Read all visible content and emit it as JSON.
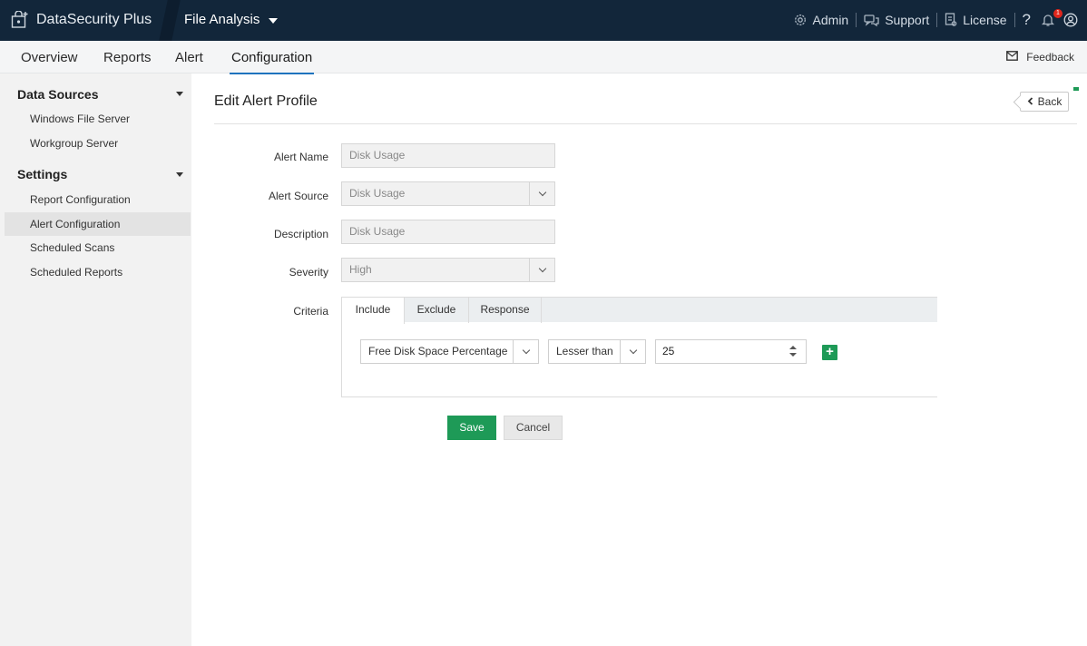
{
  "header": {
    "brand": "DataSecurity Plus",
    "product": "File Analysis",
    "admin_label": "Admin",
    "support_label": "Support",
    "license_label": "License",
    "help_glyph": "?",
    "notification_count": "1"
  },
  "nav": {
    "tabs": [
      "Overview",
      "Reports",
      "Alert",
      "Configuration"
    ],
    "active_tab": "Configuration",
    "feedback_label": "Feedback"
  },
  "sidebar": {
    "sections": [
      {
        "title": "Data Sources",
        "items": [
          "Windows File Server",
          "Workgroup Server"
        ]
      },
      {
        "title": "Settings",
        "items": [
          "Report Configuration",
          "Alert Configuration",
          "Scheduled Scans",
          "Scheduled Reports"
        ]
      }
    ],
    "active_item": "Alert Configuration"
  },
  "page": {
    "title": "Edit Alert Profile",
    "back_label": "Back"
  },
  "form": {
    "alert_name_label": "Alert Name",
    "alert_name_value": "Disk Usage",
    "alert_source_label": "Alert Source",
    "alert_source_value": "Disk Usage",
    "description_label": "Description",
    "description_value": "Disk Usage",
    "severity_label": "Severity",
    "severity_value": "High",
    "criteria_label": "Criteria",
    "criteria_tabs": [
      "Include",
      "Exclude",
      "Response"
    ],
    "criteria_active_tab": "Include",
    "criteria_field_value": "Free Disk Space Percentage",
    "criteria_operator_value": "Lesser than",
    "criteria_number_value": "25",
    "add_glyph": "+",
    "save_label": "Save",
    "cancel_label": "Cancel"
  },
  "colors": {
    "topbar_bg": "#12263a",
    "accent_green": "#1e9a57",
    "active_tab_underline": "#1e73be",
    "notification_badge": "#e0261c"
  }
}
